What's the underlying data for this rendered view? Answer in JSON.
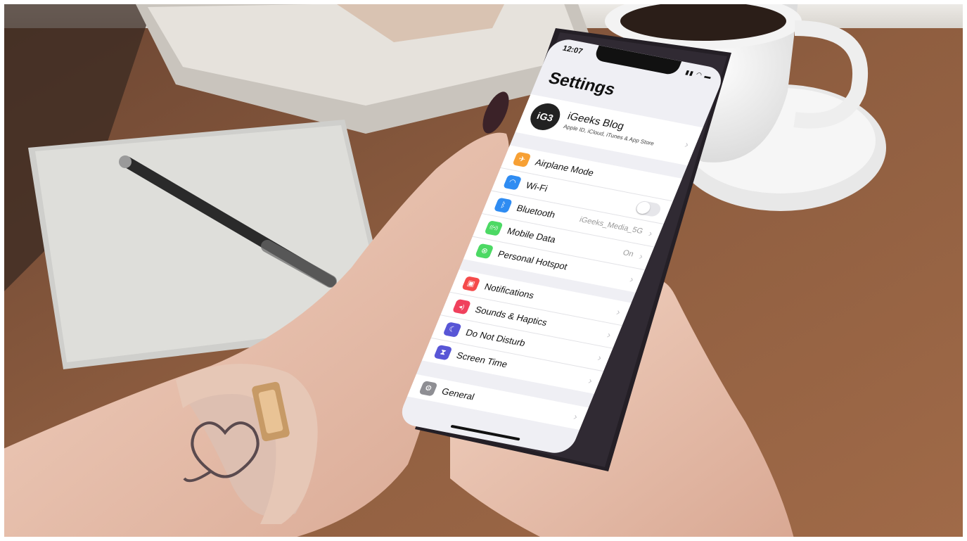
{
  "status_bar": {
    "time": "12:07",
    "icons": "▮▮ ◠ ▬"
  },
  "settings": {
    "title": "Settings",
    "profile": {
      "avatar_text": "iG3",
      "name": "iGeeks Blog",
      "subtitle": "Apple ID, iCloud, iTunes & App Store"
    },
    "connectivity": [
      {
        "label": "Airplane Mode",
        "icon": "airplane-icon",
        "color": "#f7a034",
        "glyph": "✈"
      },
      {
        "label": "Wi-Fi",
        "icon": "wifi-icon",
        "color": "#2f8cf2",
        "glyph": "◠",
        "value": "iGeeks_Media_5G"
      },
      {
        "label": "Bluetooth",
        "icon": "bluetooth-icon",
        "color": "#2f8cf2",
        "glyph": "ᛒ"
      },
      {
        "label": "Mobile Data",
        "icon": "antenna-icon",
        "color": "#4cd964",
        "glyph": "((•))",
        "value": "On"
      },
      {
        "label": "Personal Hotspot",
        "icon": "hotspot-icon",
        "color": "#4cd964",
        "glyph": "⊗"
      }
    ],
    "alerts": [
      {
        "label": "Notifications",
        "icon": "notifications-icon",
        "color": "#f54b4b",
        "glyph": "▣"
      },
      {
        "label": "Sounds & Haptics",
        "icon": "speaker-icon",
        "color": "#f0415d",
        "glyph": "◂)"
      },
      {
        "label": "Do Not Disturb",
        "icon": "moon-icon",
        "color": "#5856d6",
        "glyph": "☾"
      },
      {
        "label": "Screen Time",
        "icon": "hourglass-icon",
        "color": "#5856d6",
        "glyph": "⧗"
      }
    ],
    "general": [
      {
        "label": "General",
        "icon": "gear-icon",
        "color": "#8e8e93",
        "glyph": "⚙"
      }
    ],
    "chevron": "›"
  },
  "colors": {
    "table": "#8a5a3c",
    "wall": "#e8e6e2",
    "notebook": "#d9d9d6",
    "skin": "#e9c3b0",
    "nail": "#3b2228",
    "phone_body": "#26232a",
    "ios_background": "#efeff4"
  }
}
